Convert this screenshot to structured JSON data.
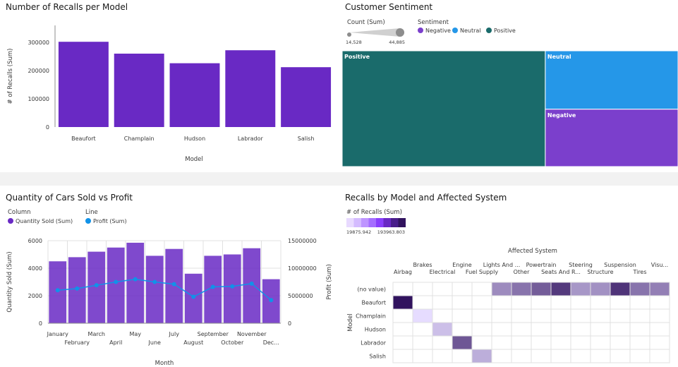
{
  "colors": {
    "purple": "#6929c4",
    "line": "#1192e8",
    "positive": "#1a6b6b",
    "neutral": "#2597e8",
    "negative": "#7b3fcc"
  },
  "recalls_panel": {
    "title": "Number of Recalls per Model"
  },
  "sentiment_panel": {
    "title": "Customer Sentiment",
    "size_legend_title": "Count (Sum)",
    "size_min": "14,528",
    "size_max": "44,885",
    "color_legend_title": "Sentiment",
    "color_items": [
      "Negative",
      "Neutral",
      "Positive"
    ]
  },
  "combo_panel": {
    "title": "Quantity of Cars Sold vs Profit",
    "column_legend_title": "Column",
    "column_item": "Quantity Sold (Sum)",
    "line_legend_title": "Line",
    "line_item": "Profit (Sum)"
  },
  "heatmap_panel": {
    "title": "Recalls by Model and Affected System",
    "legend_title": "# of Recalls (Sum)",
    "legend_min": "19875.942",
    "legend_max": "193963.803",
    "x_title": "Affected System"
  },
  "chart_data": [
    {
      "type": "bar",
      "title": "Number of Recalls per Model",
      "xlabel": "Model",
      "ylabel": "# of Recalls (Sum)",
      "categories": [
        "Beaufort",
        "Champlain",
        "Hudson",
        "Labrador",
        "Salish"
      ],
      "values": [
        302000,
        260000,
        226000,
        272000,
        212000
      ],
      "ylim": [
        0,
        360000
      ],
      "yticks": [
        "0",
        "100000",
        "200000",
        "300000"
      ]
    },
    {
      "type": "treemap",
      "title": "Customer Sentiment",
      "categories": [
        "Positive",
        "Neutral",
        "Negative"
      ],
      "values": [
        44885,
        14800,
        14528
      ]
    },
    {
      "type": "bar",
      "title": "Quantity of Cars Sold vs Profit",
      "xlabel": "Month",
      "ylabel": "Quantity Sold (Sum)",
      "y2label": "Profit (Sum)",
      "categories": [
        "January",
        "February",
        "March",
        "April",
        "May",
        "June",
        "July",
        "August",
        "September",
        "October",
        "November",
        "Dec..."
      ],
      "series": [
        {
          "name": "Quantity Sold (Sum)",
          "type": "bar",
          "values": [
            4500,
            4800,
            5200,
            5500,
            5850,
            4900,
            5400,
            3600,
            4900,
            5000,
            5450,
            3200
          ]
        },
        {
          "name": "Profit (Sum)",
          "type": "line",
          "values": [
            6000000,
            6300000,
            6900000,
            7500000,
            8000000,
            7500000,
            7100000,
            4800000,
            6600000,
            6700000,
            7200000,
            4200000
          ]
        }
      ],
      "ylim": [
        0,
        6000
      ],
      "y2lim": [
        0,
        15000000
      ],
      "yticks": [
        "0",
        "2000",
        "4000",
        "6000"
      ],
      "y2ticks": [
        "0",
        "5000000",
        "10000000",
        "15000000"
      ]
    },
    {
      "type": "heatmap",
      "title": "Recalls by Model and Affected System",
      "xlabel": "Affected System",
      "ylabel": "Model",
      "x_categories": [
        "Airbag",
        "Brakes",
        "Electrical",
        "Engine",
        "Fuel Supply",
        "Lights And ...",
        "Other",
        "Powertrain",
        "Seats And R...",
        "Steering",
        "Structure",
        "Suspension",
        "Tires",
        "Visu..."
      ],
      "y_categories": [
        "(no value)",
        "Beaufort",
        "Champlain",
        "Hudson",
        "Labrador",
        "Salish"
      ],
      "values": [
        [
          null,
          null,
          null,
          null,
          null,
          90000,
          110000,
          130000,
          160000,
          80000,
          85000,
          165000,
          110000,
          100000
        ],
        [
          193963.803,
          null,
          null,
          null,
          null,
          null,
          null,
          null,
          null,
          null,
          null,
          null,
          null,
          null
        ],
        [
          null,
          19875.942,
          null,
          null,
          null,
          null,
          null,
          null,
          null,
          null,
          null,
          null,
          null,
          null
        ],
        [
          null,
          null,
          45000,
          null,
          null,
          null,
          null,
          null,
          null,
          null,
          null,
          null,
          null,
          null
        ],
        [
          null,
          null,
          null,
          135000,
          null,
          null,
          null,
          null,
          null,
          null,
          null,
          null,
          null,
          null
        ],
        [
          null,
          null,
          null,
          null,
          60000,
          null,
          null,
          null,
          null,
          null,
          null,
          null,
          null,
          null
        ]
      ],
      "range": [
        19875.942,
        193963.803
      ]
    }
  ]
}
